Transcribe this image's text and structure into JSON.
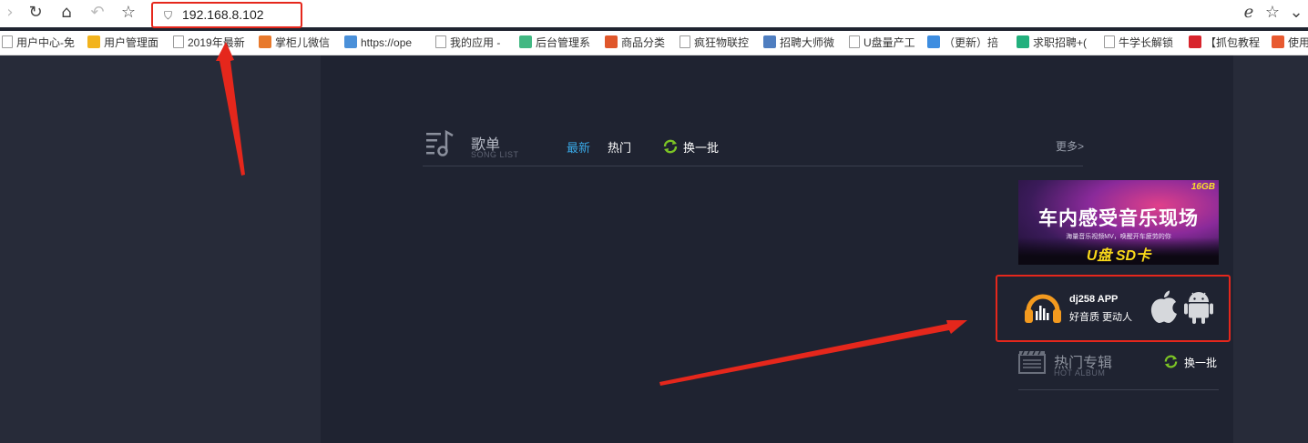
{
  "browser": {
    "url": "192.168.8.102",
    "bookmarks": [
      {
        "label": "用户中心-免",
        "color": "#d0d0d0"
      },
      {
        "label": "用户管理面",
        "color": "#f2b31d"
      },
      {
        "label": "2019年最新",
        "color": "#d0d0d0"
      },
      {
        "label": "掌柜儿微信",
        "color": "#e8792b"
      },
      {
        "label": "https://ope",
        "color": "#4a90d9"
      },
      {
        "label": "我的应用 -",
        "color": "#d0d0d0"
      },
      {
        "label": "后台管理系",
        "color": "#42b883"
      },
      {
        "label": "商品分类",
        "color": "#e0572b"
      },
      {
        "label": "疯狂物联控",
        "color": "#d0d0d0"
      },
      {
        "label": "招聘大师微",
        "color": "#4f7ec0"
      },
      {
        "label": "U盘量产工",
        "color": "#ffffff"
      },
      {
        "label": "（更新）掊",
        "color": "#3d8de0"
      },
      {
        "label": "求职招聘+(",
        "color": "#22b07d"
      },
      {
        "label": "牛学长解锁",
        "color": "#d0d0d0"
      },
      {
        "label": "【抓包教程",
        "color": "#d8242c"
      },
      {
        "label": "使用",
        "color": "#e85a30"
      }
    ]
  },
  "songlist": {
    "title": "歌单",
    "subtitle": "SONG LIST",
    "tabs": [
      "最新",
      "热门"
    ],
    "refresh_label": "换一批",
    "more_label": "更多>"
  },
  "banner": {
    "tag": "16GB",
    "title": "车内感受音乐现场",
    "subtitle": "海量音乐视频MV，唤醒开车疲劳的你",
    "usb": "U盘 SD卡"
  },
  "app_promo": {
    "name": "dj258 APP",
    "slogan": "好音质 更动人"
  },
  "hot_albums": {
    "title": "热门专辑",
    "subtitle": "HOT ALBUM",
    "refresh_label": "换一批"
  },
  "colors": {
    "accent_blue": "#39a8e6",
    "annotation_red": "#e5271c",
    "refresh_green": "#7cc425",
    "app_orange": "#f39a1f"
  }
}
